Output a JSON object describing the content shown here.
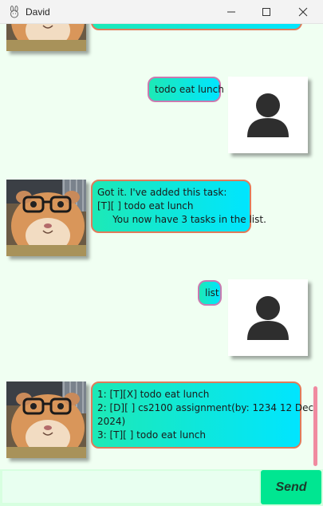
{
  "window": {
    "title": "David"
  },
  "messages": [
    {
      "sender": "bot",
      "lines": []
    },
    {
      "sender": "user",
      "lines": [
        "todo eat lunch"
      ]
    },
    {
      "sender": "bot",
      "lines": [
        "Got it. I've added this task:",
        "[T][ ] todo eat lunch",
        "     You now have 3 tasks in the list."
      ]
    },
    {
      "sender": "user",
      "lines": [
        "list"
      ]
    },
    {
      "sender": "bot",
      "lines": [
        "1: [T][X] todo eat lunch",
        "2: [D][ ] cs2100 assignment(by: 1234 12 Dec",
        "2024)",
        "3: [T][ ] todo eat lunch"
      ]
    }
  ],
  "input": {
    "value": ""
  },
  "send": {
    "label": "Send"
  },
  "icons": {
    "app": "bunny-icon",
    "user": "user-silhouette-icon",
    "bot": "hamster-with-glasses-avatar"
  },
  "colors": {
    "chat_bg": "#f0fff2",
    "bubble_start": "#1de9b6",
    "bubble_end": "#00e5ff",
    "send_button": "#00e691"
  }
}
